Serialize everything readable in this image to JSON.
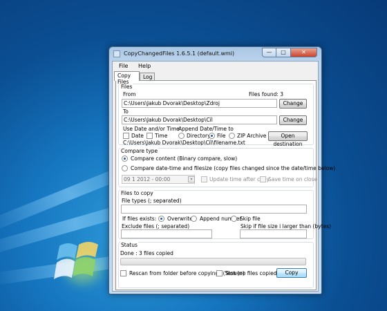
{
  "window": {
    "title": "CopyChangedFiles 1.6.5.1 (default.wmi)",
    "caption": {
      "minimize": "—",
      "maximize": "□",
      "close": "✕"
    }
  },
  "menu": [
    "File",
    "Help"
  ],
  "tabs": [
    "Copy Files",
    "Log"
  ],
  "files": {
    "legend": "Files",
    "from_label": "From",
    "files_found": "Files found: 3",
    "from_value": "C:\\Users\\Jakub Dvorak\\Desktop\\Zdroj",
    "change1": "Change",
    "to_label": "To",
    "to_value": "C:\\Users\\Jakub Dvorak\\Desktop\\Cíl",
    "change2": "Change",
    "use_date_label": "Use Date and/or Time",
    "date_chk": "Date",
    "time_chk": "Time",
    "append_label": "Append Date/Time to",
    "opt_directory": "Directory",
    "opt_file": "File",
    "opt_zip": "ZIP Archive",
    "open_dest": "Open destination",
    "preview_path": "C:\\Users\\Jakub Dvorak\\Desktop\\Cíl\\filename.txt"
  },
  "compare": {
    "legend": "Compare type",
    "opt_content": "Compare content (Binary compare, slow)",
    "opt_datetime": "Compare date-time and filesize (copy files changed since the date/time below)",
    "date_value": "09   1   2012  -  00:00",
    "update_time": "Update time after copy",
    "save_time": "Save time on close"
  },
  "filestocopy": {
    "legend": "Files to copy",
    "types_label": "File types (; separated)",
    "types_value": "",
    "if_exists": "If files exists:",
    "opt_overwrite": "Overwrite",
    "opt_append": "Append number",
    "opt_skip": "Skip file",
    "exclude_label": "Exclude files (; separated)",
    "exclude_value": "",
    "skip_size_label": "Skip if file size i larger than (bytes)",
    "skip_size_value": ""
  },
  "status": {
    "legend": "Status",
    "text": "Done : 3 files copied",
    "progress": 0,
    "rescan": "Rescan from folder before copying? (Slower)",
    "test": "Test (no files copied)",
    "copy": "Copy"
  },
  "colors": {
    "accent": "#1c5fa6",
    "desktop": "#0b4f93"
  }
}
